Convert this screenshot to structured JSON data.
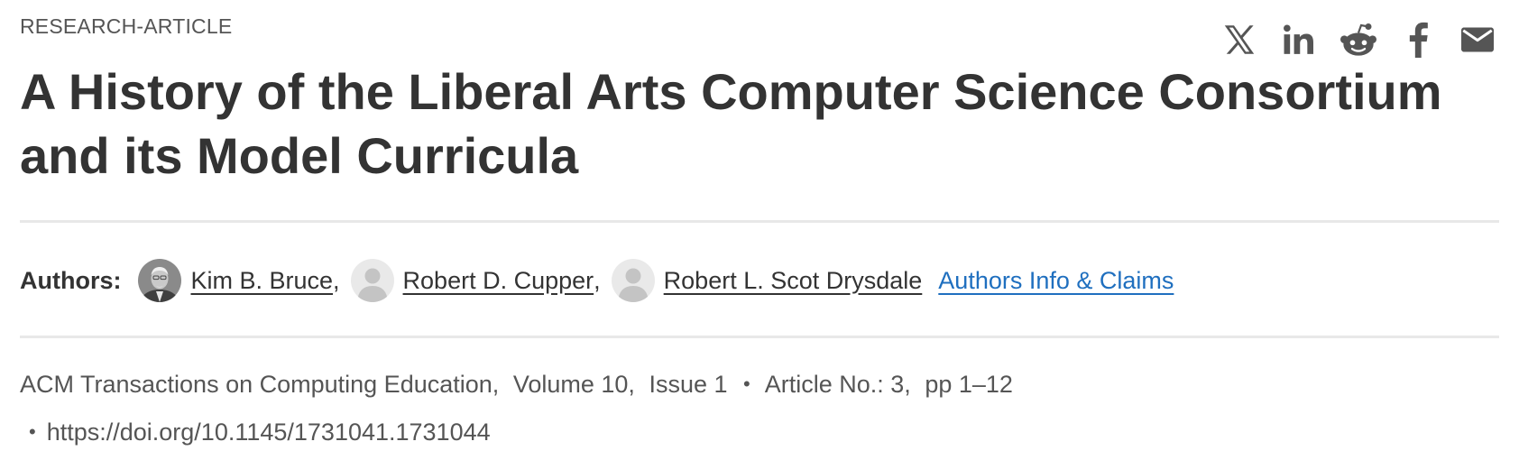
{
  "article": {
    "type": "RESEARCH-ARTICLE",
    "title": "A History of the Liberal Arts Computer Science Consortium and its Model Curricula"
  },
  "share": {
    "icons": [
      "x-icon",
      "linkedin-icon",
      "reddit-icon",
      "facebook-icon",
      "email-icon"
    ],
    "icon_color": "#555555"
  },
  "authors": {
    "label": "Authors:",
    "list": [
      {
        "name": "Kim B. Bruce",
        "sep": ","
      },
      {
        "name": "Robert D. Cupper",
        "sep": ","
      },
      {
        "name": "Robert L. Scot Drysdale",
        "sep": ""
      }
    ],
    "info_link": "Authors Info & Claims",
    "link_color": "#1f6fbf"
  },
  "publication": {
    "journal": "ACM Transactions on Computing Education",
    "volume": "Volume 10",
    "issue": "Issue 1",
    "article_no": "Article No.: 3",
    "pages": "pp 1–12",
    "bullet": "•",
    "doi": "https://doi.org/10.1145/1731041.1731044"
  }
}
